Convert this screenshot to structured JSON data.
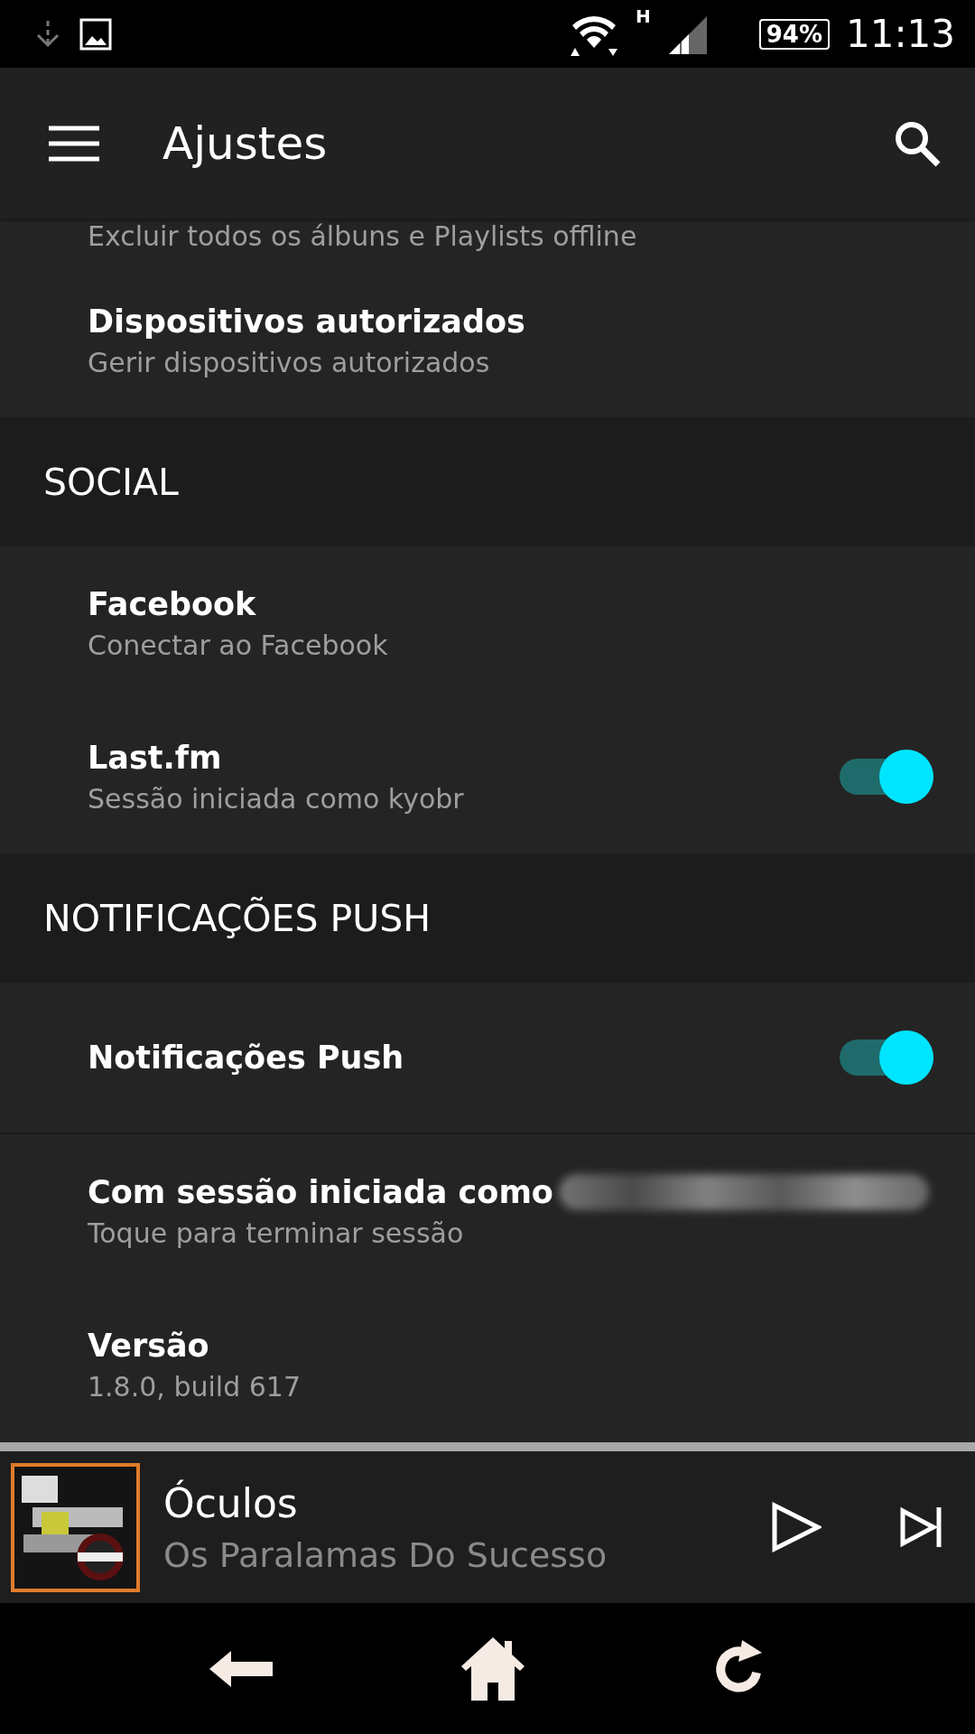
{
  "status_bar": {
    "network": "H",
    "battery": "94%",
    "time": "11:13"
  },
  "app_bar": {
    "title": "Ajustes"
  },
  "partial_item": {
    "subtitle": "Excluir todos os álbuns e Playlists offline"
  },
  "sections": [
    {
      "kind": "items",
      "items": [
        {
          "kind": "plain",
          "title": "Dispositivos autorizados",
          "subtitle": "Gerir dispositivos autorizados"
        }
      ]
    },
    {
      "kind": "header",
      "title": "SOCIAL"
    },
    {
      "kind": "items",
      "items": [
        {
          "kind": "plain",
          "title": "Facebook",
          "subtitle": "Conectar ao Facebook"
        },
        {
          "kind": "toggle",
          "title": "Last.fm",
          "subtitle": "Sessão iniciada como kyobr",
          "on": true
        }
      ]
    },
    {
      "kind": "header",
      "title": "NOTIFICAÇÕES PUSH"
    },
    {
      "kind": "items",
      "items": [
        {
          "kind": "toggle",
          "title": "Notificações Push",
          "on": true,
          "divider": true
        },
        {
          "kind": "redacted",
          "title": "Com sessão iniciada como",
          "subtitle": "Toque para terminar sessão"
        },
        {
          "kind": "plain",
          "title": "Versão",
          "subtitle": "1.8.0, build 617"
        }
      ]
    }
  ],
  "player": {
    "title": "Óculos",
    "artist": "Os Paralamas Do Sucesso"
  }
}
